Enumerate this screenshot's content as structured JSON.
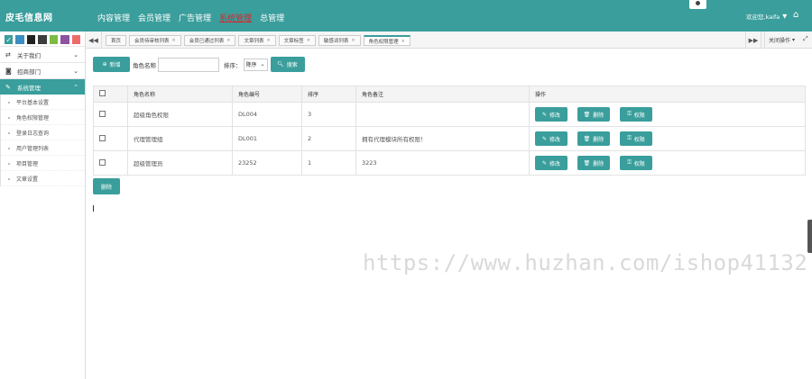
{
  "brand": "皮毛信息网",
  "topnav": [
    {
      "label": "内容管理",
      "active": false
    },
    {
      "label": "会员管理",
      "active": false
    },
    {
      "label": "广告管理",
      "active": false
    },
    {
      "label": "系统管理",
      "active": true
    },
    {
      "label": "总管理",
      "active": false
    }
  ],
  "user": {
    "name": "欢迎您,kaifa",
    "dropdown_icon": "caret-down-icon"
  },
  "swatches": [
    "#3a9e9c",
    "#3b8ec2",
    "#222222",
    "#3d3d3d",
    "#7dbb45",
    "#8e52a1",
    "#ee6a6a"
  ],
  "sidebar": {
    "groups": [
      {
        "label": "关于我们",
        "icon": "shuffle-icon",
        "open": false
      },
      {
        "label": "招商部门",
        "icon": "camera-icon",
        "open": false
      },
      {
        "label": "系统管理",
        "icon": "wrench-icon",
        "open": true
      }
    ],
    "subitems": [
      "平台基本设置",
      "角色权限管理",
      "登录日志查询",
      "用户管理列表",
      "项目管理",
      "文章设置"
    ]
  },
  "tabs": [
    {
      "label": "首页",
      "closable": false,
      "current": false
    },
    {
      "label": "会员待审核列表",
      "closable": true,
      "current": false
    },
    {
      "label": "会员已通过列表",
      "closable": true,
      "current": false
    },
    {
      "label": "文章列表",
      "closable": true,
      "current": false
    },
    {
      "label": "文章标签",
      "closable": true,
      "current": false
    },
    {
      "label": "敏感词列表",
      "closable": true,
      "current": false
    },
    {
      "label": "角色权限管理",
      "closable": true,
      "current": true
    }
  ],
  "tab_close_ops": "关闭操作",
  "toolbar": {
    "add_label": "新增",
    "role_name_label": "角色名称",
    "role_name_value": "",
    "sort_label": "排序：",
    "sort_value": "降序",
    "search_label": "搜索",
    "delete_label": "删除"
  },
  "table": {
    "headers": [
      "角色名称",
      "角色编号",
      "排序",
      "角色备注",
      "操作"
    ],
    "rows": [
      {
        "name": "超级角色权限",
        "code": "DL004",
        "sort": "3",
        "note": ""
      },
      {
        "name": "代理管理组",
        "code": "DL001",
        "sort": "2",
        "note": "拥有代理模块所有权限！"
      },
      {
        "name": "超级管理员",
        "code": "23252",
        "sort": "1",
        "note": "3223"
      }
    ],
    "actions": {
      "edit": "修改",
      "delete": "删除",
      "permission": "权限"
    }
  },
  "watermark": "https://www.huzhan.com/ishop41132"
}
